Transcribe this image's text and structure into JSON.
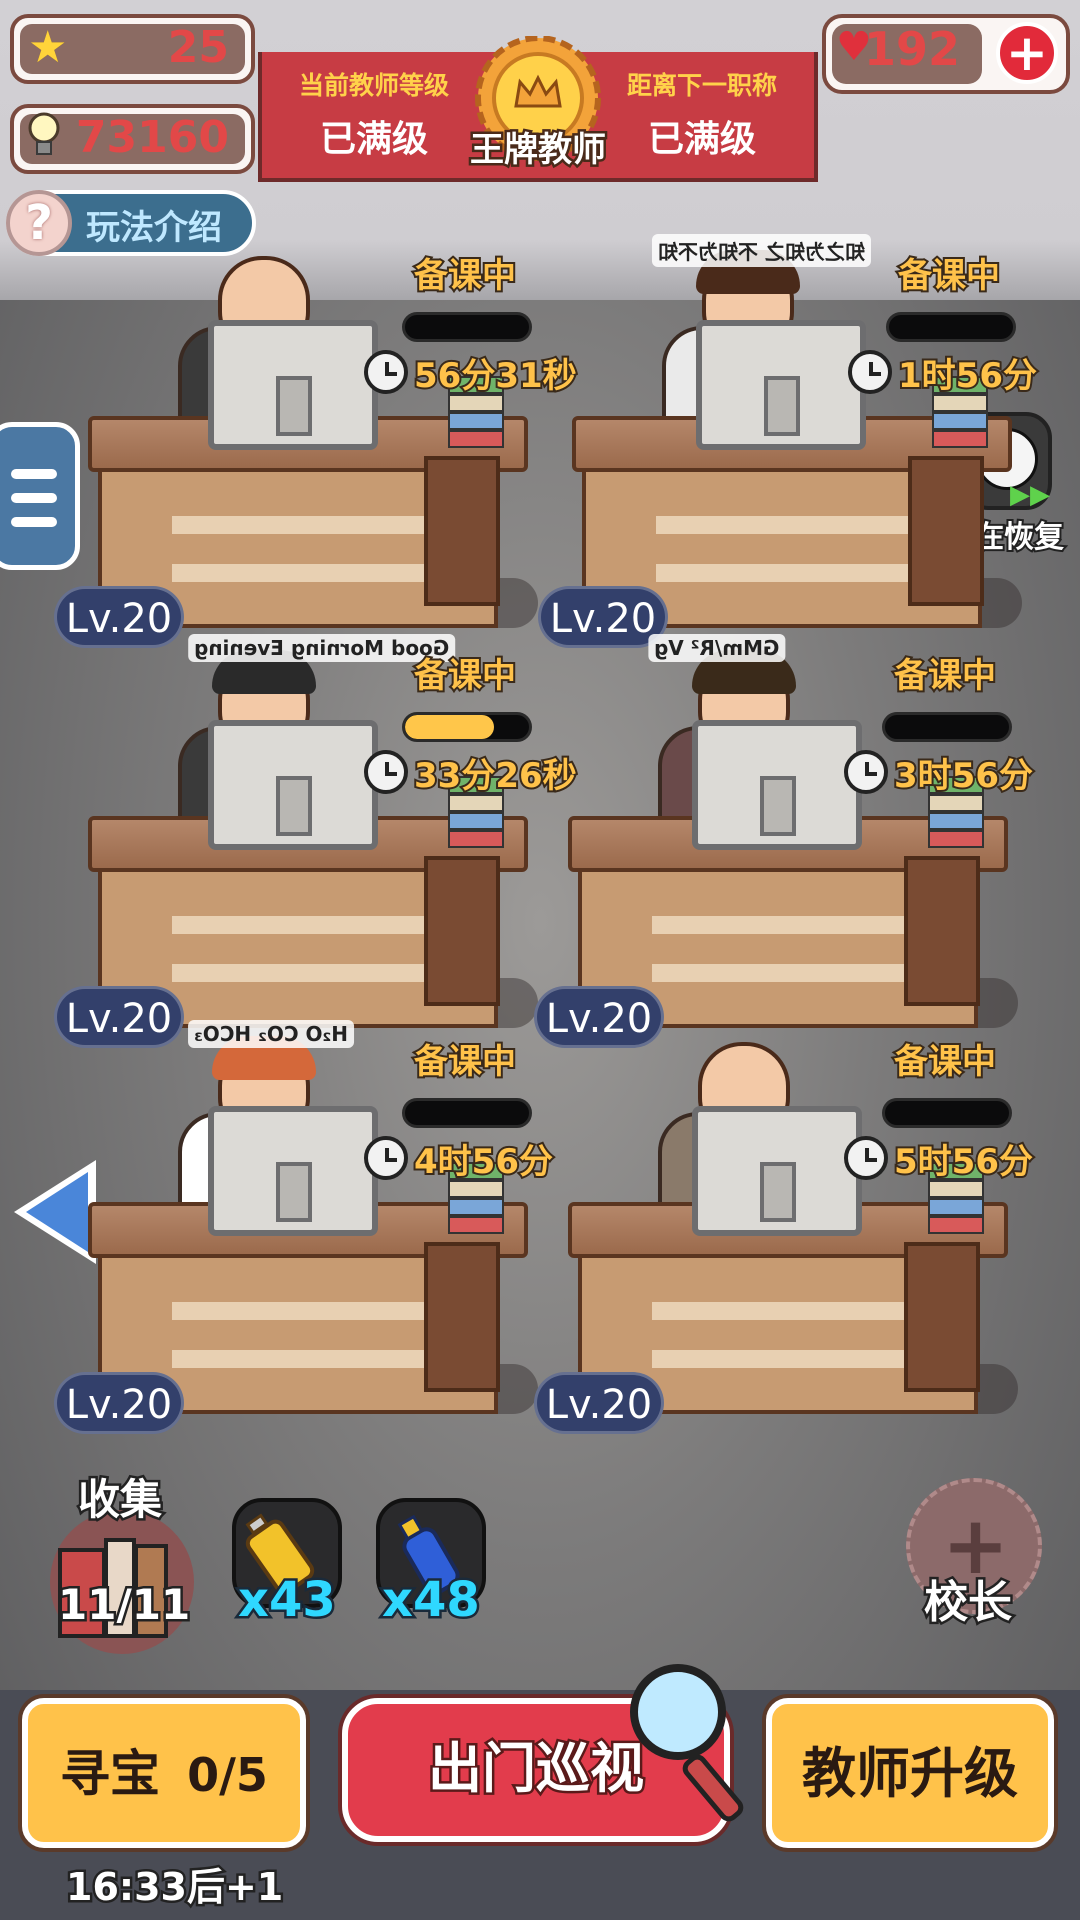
{
  "hud": {
    "stars": "25",
    "ideas": "73160",
    "hearts": "192",
    "howto_label": "玩法介绍",
    "banner": {
      "left_caption": "当前教师等级",
      "left_status": "已满级",
      "title": "王牌教师",
      "right_caption": "距离下一职称",
      "right_status": "已满级"
    }
  },
  "side": {
    "recover_label": "正在恢复"
  },
  "teachers": [
    {
      "status": "备课中",
      "timer": "56分31秒",
      "level": "Lv.20",
      "progress": 0.0
    },
    {
      "status": "备课中",
      "timer": "1时56分",
      "level": "Lv.20",
      "progress": 0.0,
      "bubble": "知之为知之 不知为不知"
    },
    {
      "status": "备课中",
      "timer": "33分26秒",
      "level": "Lv.20",
      "progress": 0.72,
      "bubble": "Good Morning Evening"
    },
    {
      "status": "备课中",
      "timer": "3时56分",
      "level": "Lv.20",
      "progress": 0.0,
      "bubble": "GMm/R² Vg"
    },
    {
      "status": "备课中",
      "timer": "4时56分",
      "level": "Lv.20",
      "progress": 0.0,
      "bubble": "H₂O CO₂ HCO₃"
    },
    {
      "status": "备课中",
      "timer": "5时56分",
      "level": "Lv.20",
      "progress": 0.0
    }
  ],
  "bottom": {
    "collect_label": "收集",
    "collect_count": "11/11",
    "item1_count": "x43",
    "item2_count": "x48",
    "principal_label": "校长",
    "treasure_label": "寻宝",
    "treasure_count": "0/5",
    "treasure_timer": "16:33后+1",
    "patrol_label": "出门巡视",
    "upgrade_label": "教师升级"
  },
  "colors": {
    "accent_yellow": "#ffc24a",
    "banner_red": "#c73c44",
    "level_badge": "#33406b",
    "item_count": "#2fd8ff"
  }
}
